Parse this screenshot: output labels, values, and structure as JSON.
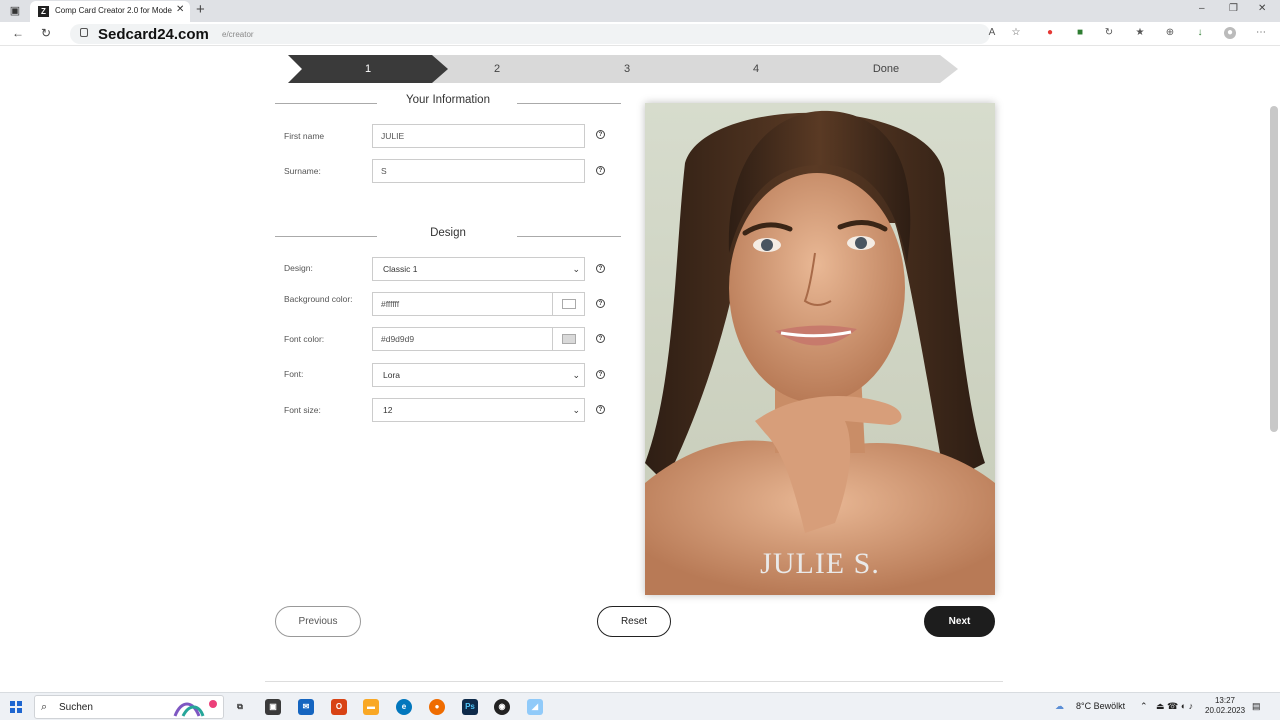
{
  "browser": {
    "tab_title": "Comp Card Creator 2.0 for Mode",
    "tab_favicon": "Z",
    "url_site": "Sedcard24.com",
    "url_path": "e/creator",
    "window_controls": [
      "–",
      "❐",
      "✕"
    ]
  },
  "steps": [
    {
      "label": "1",
      "active": true
    },
    {
      "label": "2",
      "active": false
    },
    {
      "label": "3",
      "active": false
    },
    {
      "label": "4",
      "active": false
    },
    {
      "label": "Done",
      "active": false
    }
  ],
  "info_section": {
    "title": "Your Information",
    "first_name_label": "First name",
    "first_name_value": "JULIE",
    "surname_label": "Surname:",
    "surname_value": "S"
  },
  "design_section": {
    "title": "Design",
    "design_label": "Design:",
    "design_value": "Classic 1",
    "bg_label": "Background color:",
    "bg_value": "#ffffff",
    "bg_swatch": "#ffffff",
    "font_color_label": "Font color:",
    "font_color_value": "#d9d9d9",
    "font_color_swatch": "#d9d9d9",
    "font_label": "Font:",
    "font_value": "Lora",
    "font_size_label": "Font size:",
    "font_size_value": "12"
  },
  "help_glyph": "?",
  "preview": {
    "name": "JULIE S."
  },
  "buttons": {
    "previous": "Previous",
    "reset": "Reset",
    "next": "Next"
  },
  "taskbar": {
    "search_placeholder": "Suchen",
    "weather": "8°C Bewölkt",
    "time": "13:27",
    "date": "20.02.2023"
  },
  "colors": {
    "accent_dark": "#1d1d1d",
    "step_active": "#3a3a3a",
    "step_inactive": "#d9d9d9"
  }
}
